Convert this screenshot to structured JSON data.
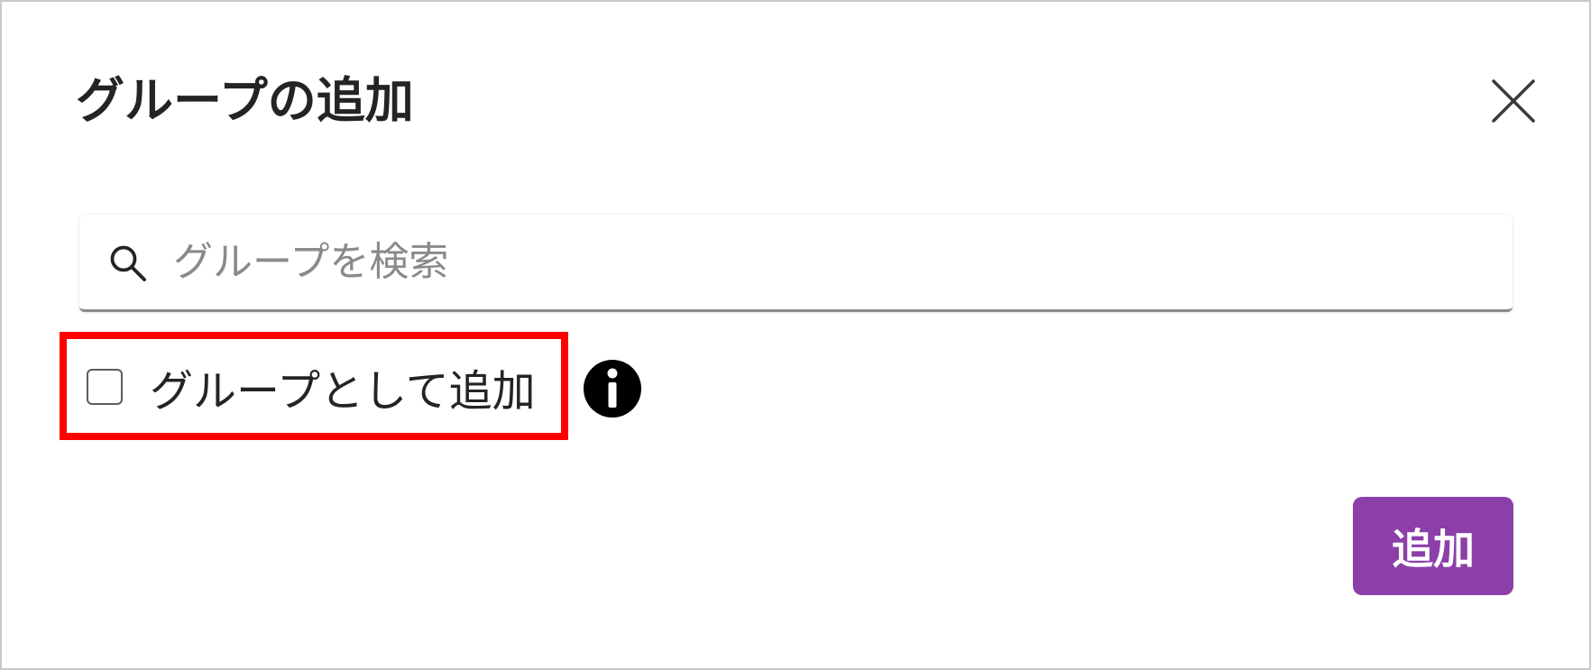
{
  "dialog": {
    "title": "グループの追加",
    "close_icon": "close-icon"
  },
  "search": {
    "icon": "search-icon",
    "placeholder": "グループを検索",
    "value": ""
  },
  "add_as_group": {
    "checked": false,
    "label": "グループとして追加",
    "info_icon": "info-icon"
  },
  "footer": {
    "add_label": "追加"
  },
  "colors": {
    "accent": "#8c3fa8",
    "highlight": "#ff0000",
    "text": "#242424",
    "placeholder": "#8a8a8a"
  }
}
